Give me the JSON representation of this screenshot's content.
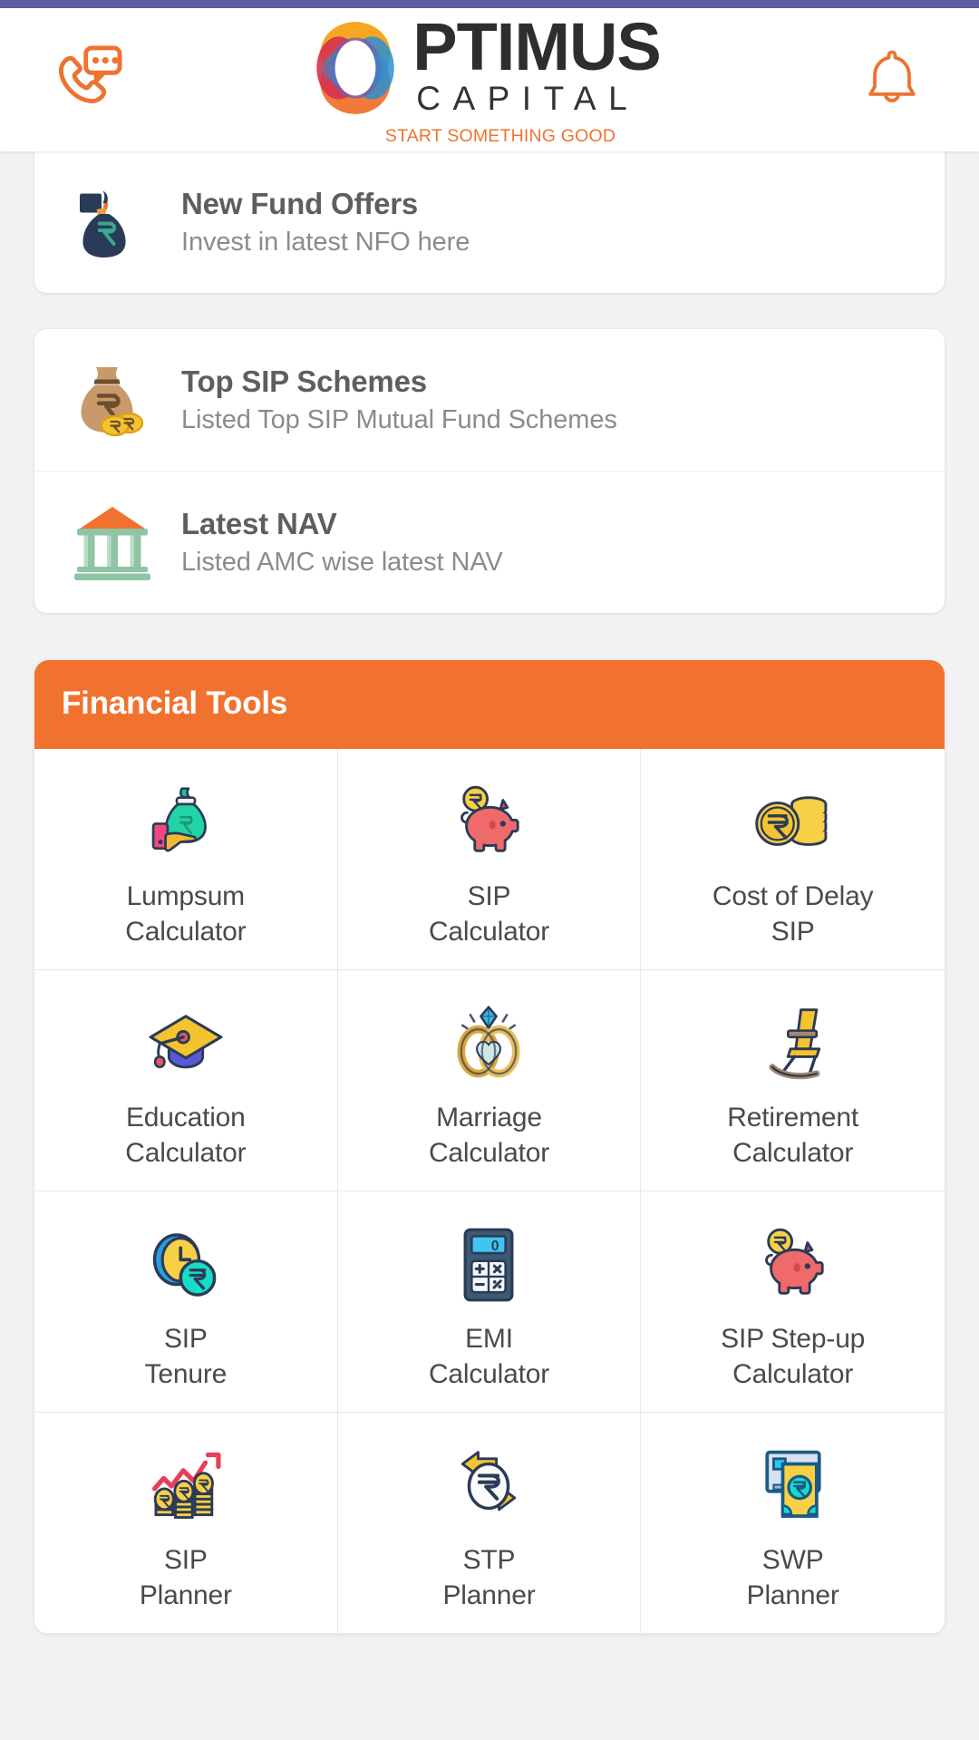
{
  "status_bar": {
    "color": "#5d5fa6"
  },
  "header": {
    "support_icon": "phone-chat-icon",
    "notification_icon": "bell-icon",
    "logo": {
      "name_primary": "PTIMUS",
      "name_secondary": "CAPITAL",
      "tagline": "START SOMETHING GOOD",
      "ring_colors": [
        "#f6a623",
        "#d6334c",
        "#2a8fd4",
        "#7a5ba8",
        "#f1722f"
      ],
      "tagline_color": "#f1722f"
    }
  },
  "info_cards": [
    {
      "rows": [
        {
          "icon": "money-bag-navy-icon",
          "title": "New Fund Offers",
          "subtitle": "Invest in latest NFO here"
        }
      ]
    },
    {
      "rows": [
        {
          "icon": "money-bag-coins-icon",
          "title": "Top SIP Schemes",
          "subtitle": "Listed Top SIP Mutual Fund Schemes"
        },
        {
          "icon": "bank-building-icon",
          "title": "Latest NAV",
          "subtitle": "Listed AMC wise latest NAV"
        }
      ]
    }
  ],
  "financial_tools": {
    "header_title": "Financial Tools",
    "header_color": "#f1722f",
    "items": [
      {
        "icon": "hand-money-bag-icon",
        "line1": "Lumpsum",
        "line2": "Calculator"
      },
      {
        "icon": "piggy-bank-icon",
        "line1": "SIP",
        "line2": "Calculator"
      },
      {
        "icon": "coin-stack-rupee-icon",
        "line1": "Cost of Delay",
        "line2": "SIP"
      },
      {
        "icon": "graduation-cap-icon",
        "line1": "Education",
        "line2": "Calculator"
      },
      {
        "icon": "wedding-rings-icon",
        "line1": "Marriage",
        "line2": "Calculator"
      },
      {
        "icon": "rocking-chair-icon",
        "line1": "Retirement",
        "line2": "Calculator"
      },
      {
        "icon": "clock-coin-icon",
        "line1": "SIP",
        "line2": "Tenure"
      },
      {
        "icon": "calculator-icon",
        "line1": "EMI",
        "line2": "Calculator"
      },
      {
        "icon": "piggy-bank-coin-icon",
        "line1": "SIP Step-up",
        "line2": "Calculator"
      },
      {
        "icon": "growth-chart-coins-icon",
        "line1": "SIP",
        "line2": "Planner"
      },
      {
        "icon": "transfer-arrows-rupee-icon",
        "line1": "STP",
        "line2": "Planner"
      },
      {
        "icon": "atm-withdraw-icon",
        "line1": "SWP",
        "line2": "Planner"
      }
    ]
  }
}
